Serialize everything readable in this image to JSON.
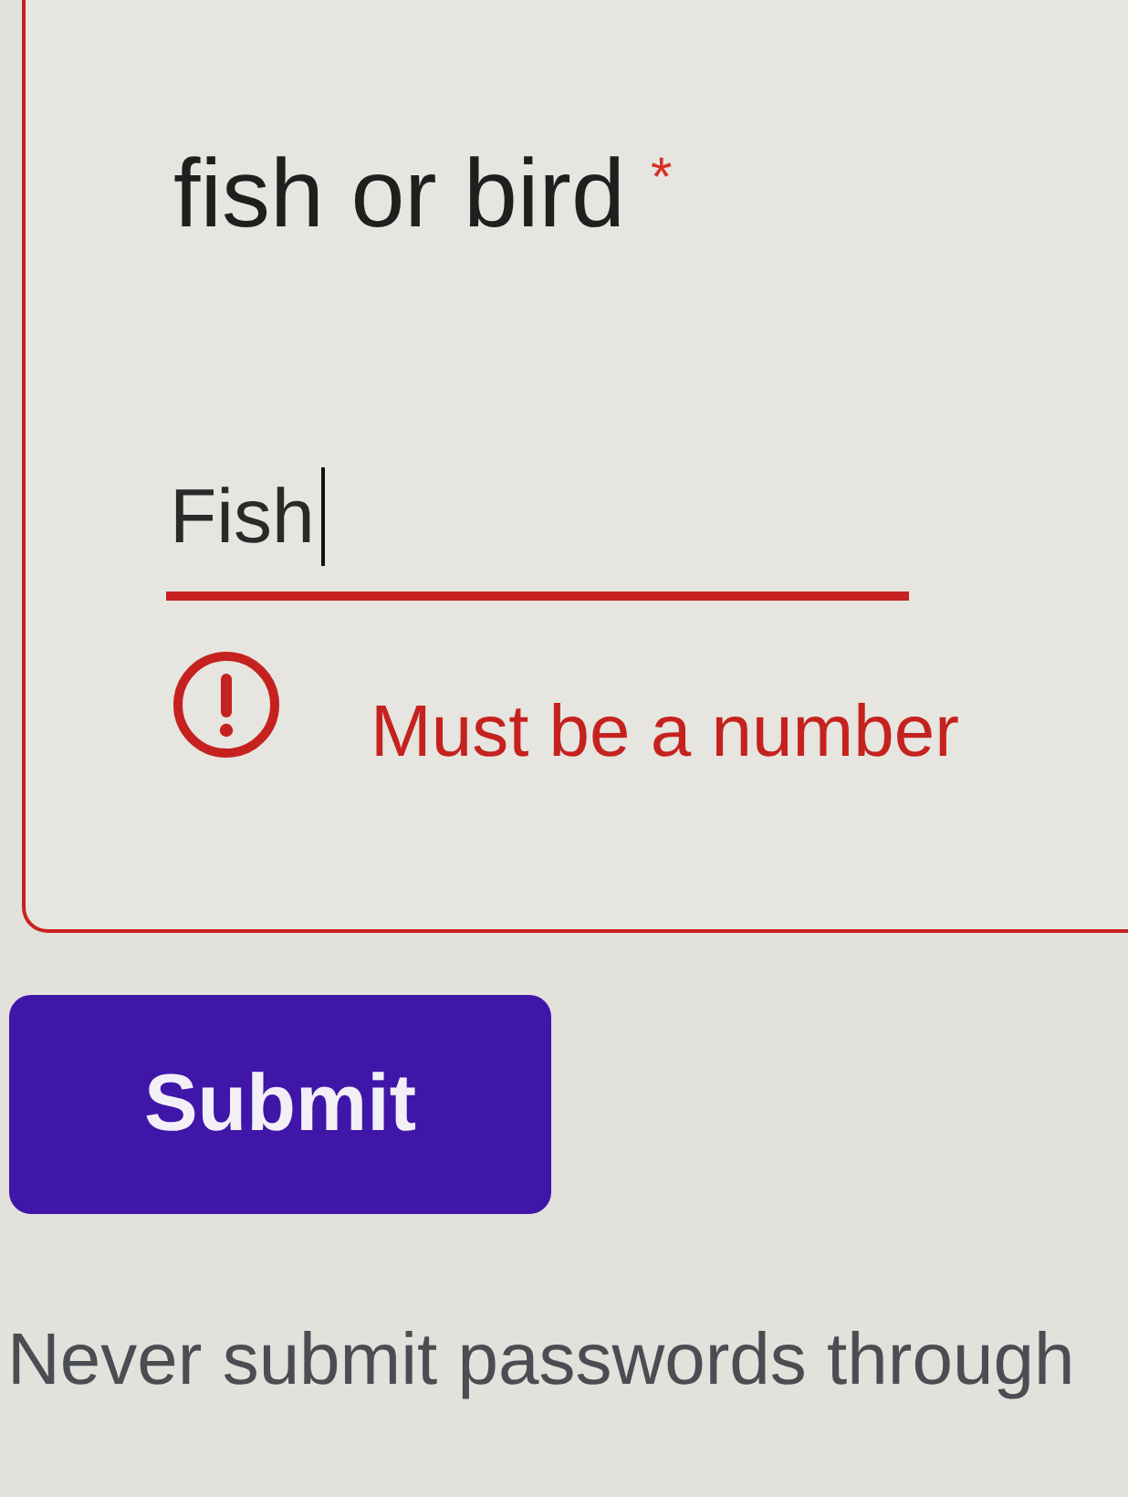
{
  "question": {
    "title": "fish or bird",
    "required_mark": "*",
    "answer": "Fish",
    "focused": true,
    "invalid": true,
    "error": "Must be a number"
  },
  "submit_button": {
    "label": "Submit"
  },
  "footer": {
    "text": "Never submit passwords through"
  }
}
